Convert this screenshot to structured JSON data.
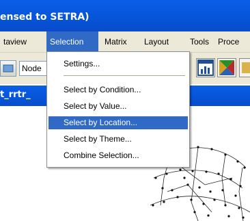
{
  "window": {
    "title": "ensed to SETRA)"
  },
  "menubar": {
    "items": [
      {
        "label": "taview"
      },
      {
        "label": "Selection",
        "active": true
      },
      {
        "label": "Matrix"
      },
      {
        "label": "Layout"
      },
      {
        "label": "Tools"
      },
      {
        "label": "Proce"
      }
    ]
  },
  "toolbar": {
    "layer_combo_value": "Node"
  },
  "document": {
    "title": "t_rrtr_"
  },
  "selection_menu": {
    "items": [
      {
        "label": "Settings..."
      },
      {
        "label": "Select by Condition..."
      },
      {
        "label": "Select by Value..."
      },
      {
        "label": "Select by Location...",
        "highlighted": true
      },
      {
        "label": "Select by Theme..."
      },
      {
        "label": "Combine Selection..."
      }
    ]
  },
  "colors": {
    "accent": "#316ac5",
    "titlebar": "#0654d8",
    "menu_bg": "#ece9d8"
  }
}
